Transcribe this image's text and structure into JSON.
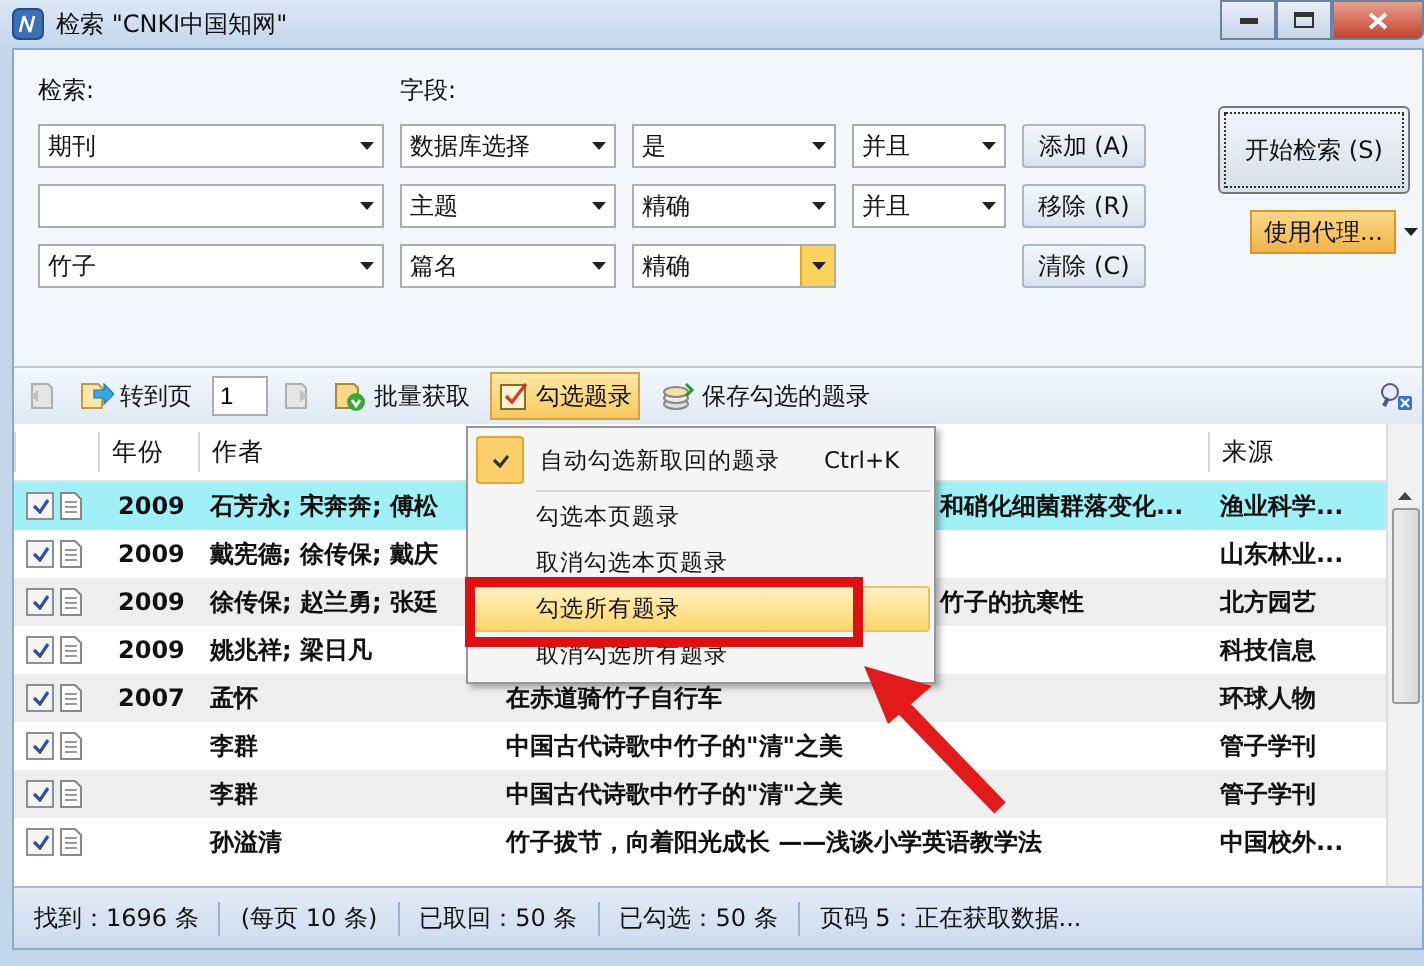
{
  "window": {
    "title": "检索 \"CNKI中国知网\""
  },
  "search_form": {
    "search_label": "检索:",
    "field_label": "字段:",
    "criteria": [
      {
        "scope": "期刊",
        "field": "数据库选择",
        "match": "是",
        "logic": "并且",
        "match_focused": false
      },
      {
        "field": "主题",
        "match": "精确",
        "logic": "并且",
        "match_focused": false
      },
      {
        "scope": "竹子",
        "field": "篇名",
        "match": "精确",
        "match_focused": true
      }
    ],
    "side_buttons": [
      "添加 (A)",
      "移除 (R)",
      "清除 (C)"
    ],
    "start_button": "开始检索 (S)",
    "proxy_button": "使用代理..."
  },
  "toolbar": {
    "goto_label": "转到页",
    "page": "1",
    "buttons": [
      {
        "kind": "batch",
        "label": "批量获取",
        "selected": false
      },
      {
        "kind": "check",
        "label": "勾选题录",
        "selected": true
      },
      {
        "kind": "save",
        "label": "保存勾选的题录",
        "selected": false
      }
    ]
  },
  "menu": {
    "items": [
      {
        "kind": "check",
        "label": "自动勾选新取回的题录",
        "shortcut": "Ctrl+K",
        "checked": true,
        "selected": false
      },
      {
        "kind": "separator"
      },
      {
        "kind": "item",
        "label": "勾选本页题录",
        "selected": false
      },
      {
        "kind": "item",
        "label": "取消勾选本页题录",
        "selected": false
      },
      {
        "kind": "item",
        "label": "勾选所有题录",
        "selected": true
      },
      {
        "kind": "item",
        "label": "取消勾选所有题录",
        "selected": false
      }
    ]
  },
  "table": {
    "columns": {
      "year": "年份",
      "author": "作者",
      "source": "来源"
    },
    "rows": [
      {
        "checked": true,
        "selected": true,
        "year": "2009",
        "author": "石芳永; 宋奔奔; 傅松",
        "title": "和硝化细菌群落变化...",
        "title_covered": true,
        "source": "渔业科学..."
      },
      {
        "checked": true,
        "selected": false,
        "year": "2009",
        "author": "戴宪德; 徐传保; 戴庆",
        "source": "山东林业..."
      },
      {
        "checked": true,
        "selected": false,
        "year": "2009",
        "author": "徐传保; 赵兰勇; 张廷",
        "title": "竹子的抗寒性",
        "title_covered": true,
        "source": "北方园艺"
      },
      {
        "checked": true,
        "selected": false,
        "year": "2009",
        "author": "姚兆祥; 梁日凡",
        "source": "科技信息"
      },
      {
        "checked": true,
        "selected": false,
        "year": "2007",
        "author": "孟怀",
        "title": "在赤道骑竹子自行车",
        "title_covered": false,
        "source": "环球人物"
      },
      {
        "checked": true,
        "selected": false,
        "author": "李群",
        "title": "中国古代诗歌中竹子的\"清\"之美",
        "title_covered": false,
        "source": "管子学刊"
      },
      {
        "checked": true,
        "selected": false,
        "author": "李群",
        "title": "中国古代诗歌中竹子的\"清\"之美",
        "title_covered": false,
        "source": "管子学刊"
      },
      {
        "checked": true,
        "selected": false,
        "author": "孙溢清",
        "title": "竹子拔节，向着阳光成长 ——浅谈小学英语教学法",
        "title_covered": false,
        "source": "中国校外..."
      }
    ]
  },
  "status_bar": [
    "找到：1696 条",
    "(每页 10 条)",
    "已取回：50 条",
    "已勾选：50 条",
    "页码 5：正在获取数据..."
  ]
}
